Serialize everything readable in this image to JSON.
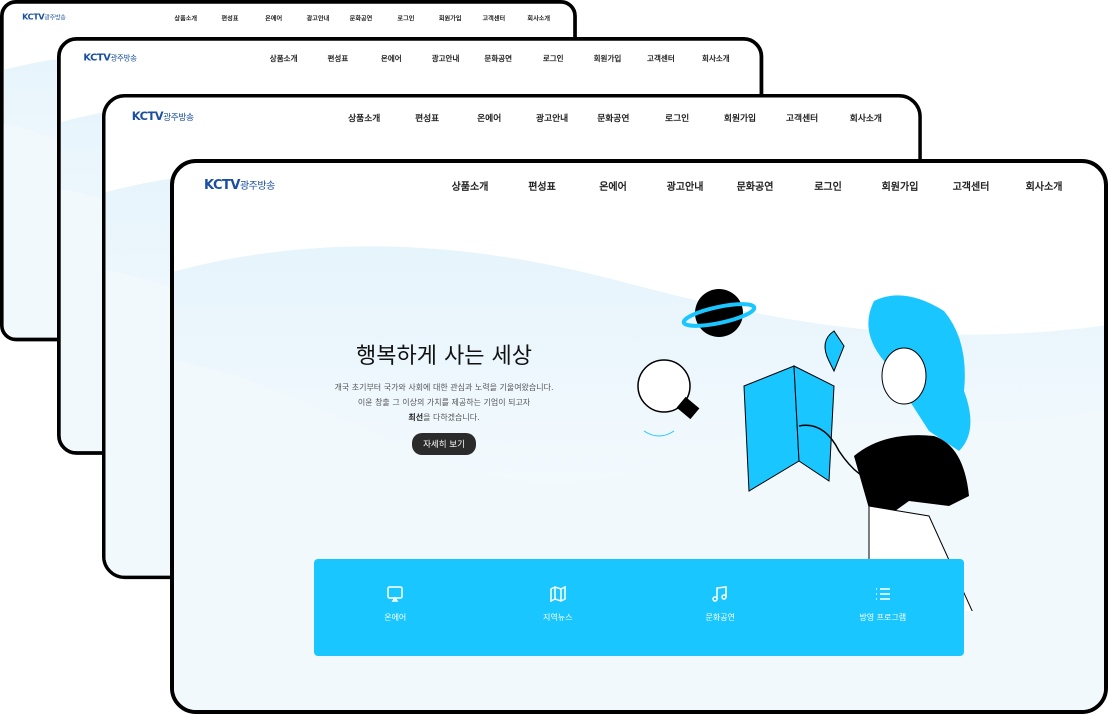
{
  "brand": {
    "logo": "KCTV",
    "logo_sub": "광주방송"
  },
  "nav": [
    "상품소개",
    "편성표",
    "온에어",
    "광고안내",
    "문화공연",
    "로그인",
    "회원가입",
    "고객센터",
    "회사소개"
  ],
  "hero": {
    "title": "행복하게 사는 세상",
    "line1": "개국 초기부터 국가와 사회에 대한 관심과 노력을 기울여왔습니다.",
    "line2": "이윤 창출 그 이상의 가치를 제공하는 기업이 되고자",
    "line3_bold": "최선",
    "line3_rest": "을 다하겠습니다.",
    "button": "자세히 보기"
  },
  "quick_menu": [
    {
      "label": "온에어",
      "icon": "tv-icon"
    },
    {
      "label": "지역뉴스",
      "icon": "map-icon"
    },
    {
      "label": "문화공연",
      "icon": "music-icon"
    },
    {
      "label": "방영 프로그램",
      "icon": "list-icon"
    }
  ],
  "colors": {
    "accent": "#1ac6ff",
    "logo": "#1a4fa0",
    "button": "#2b2b2b"
  }
}
